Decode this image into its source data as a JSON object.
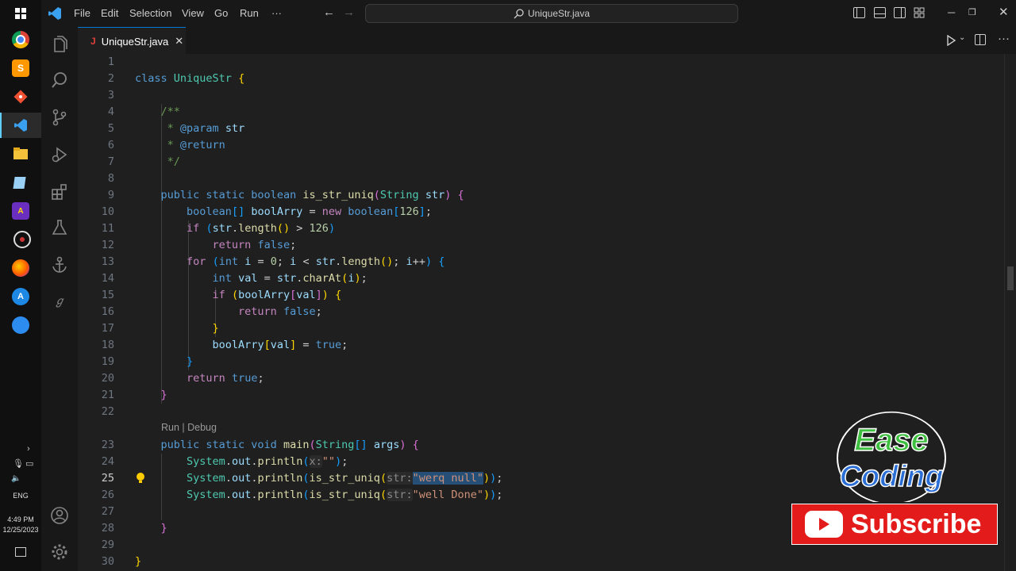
{
  "titlebar": {
    "menu": [
      "File",
      "Edit",
      "Selection",
      "View",
      "Go",
      "Run",
      "···"
    ],
    "search": "UniqueStr.java"
  },
  "tab": {
    "label": "UniqueStr.java",
    "lang_badge": "J"
  },
  "codelens": "Run | Debug",
  "line_numbers": [
    "1",
    "2",
    "3",
    "4",
    "5",
    "6",
    "7",
    "8",
    "9",
    "10",
    "11",
    "12",
    "13",
    "14",
    "15",
    "16",
    "17",
    "18",
    "19",
    "20",
    "21",
    "22",
    "23",
    "24",
    "25",
    "26",
    "27",
    "28",
    "29",
    "30"
  ],
  "code": {
    "class_kw": "class",
    "class_name": "UniqueStr",
    "comment_open": "/**",
    "param_tag": "@param",
    "param_name": "str",
    "return_tag": "@return",
    "comment_close": "*/",
    "str_length_limit": "126",
    "arg1_str": "\"\"",
    "arg2_str": "\"werq null\"",
    "arg3_str": "\"well Done\""
  },
  "taskbar": {
    "language": "ENG",
    "time": "4:49 PM",
    "date": "12/25/2023"
  },
  "overlay": {
    "logo_line1": "Ease",
    "logo_line2": "Coding",
    "subscribe": "Subscribe"
  },
  "colors": {
    "accent": "#0078d4",
    "subscribe_red": "#e31b1b",
    "logo_green": "#3fbf3f",
    "logo_blue": "#2b6fd6"
  }
}
